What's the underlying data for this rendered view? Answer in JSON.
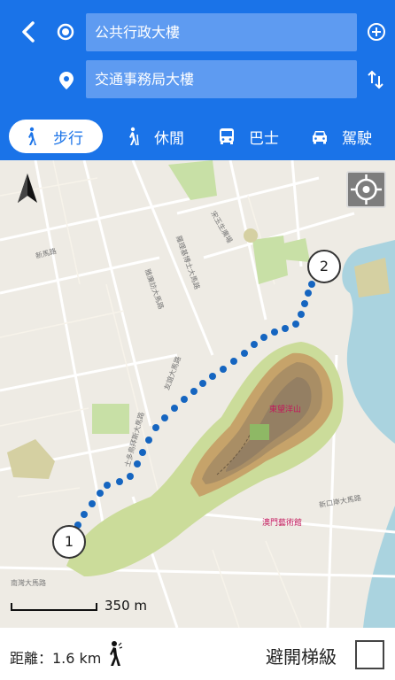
{
  "route_form": {
    "origin_value": "公共行政大樓",
    "destination_value": "交通事務局大樓"
  },
  "modes": [
    {
      "label": "步行",
      "icon": "walking-icon",
      "selected": true
    },
    {
      "label": "休閒",
      "icon": "hiking-icon",
      "selected": false
    },
    {
      "label": "巴士",
      "icon": "bus-icon",
      "selected": false
    },
    {
      "label": "駕駛",
      "icon": "car-icon",
      "selected": false
    }
  ],
  "map": {
    "markers": [
      "1",
      "2"
    ],
    "scale_label": "350 m",
    "poi_labels": [
      "東望洋山",
      "澳門藝術館"
    ],
    "road_labels": [
      "新馬路",
      "南灣大馬路",
      "友誼大馬路",
      "士多鳥拜斯大馬路",
      "雅廉訪大馬路",
      "羅理基博士大馬路",
      "宋玉生廣場",
      "新口岸大馬路"
    ],
    "route_color": "#1565c0"
  },
  "footer": {
    "distance_label": "距離：1.6 km",
    "avoid_stairs_label": "避開梯級",
    "avoid_stairs_checked": false
  },
  "colors": {
    "header_bg": "#1a73e8",
    "field_bg": "#5e9bf1",
    "map_bg": "#eeebe4",
    "park_green": "#c8e0a6",
    "water": "#aad3df"
  }
}
